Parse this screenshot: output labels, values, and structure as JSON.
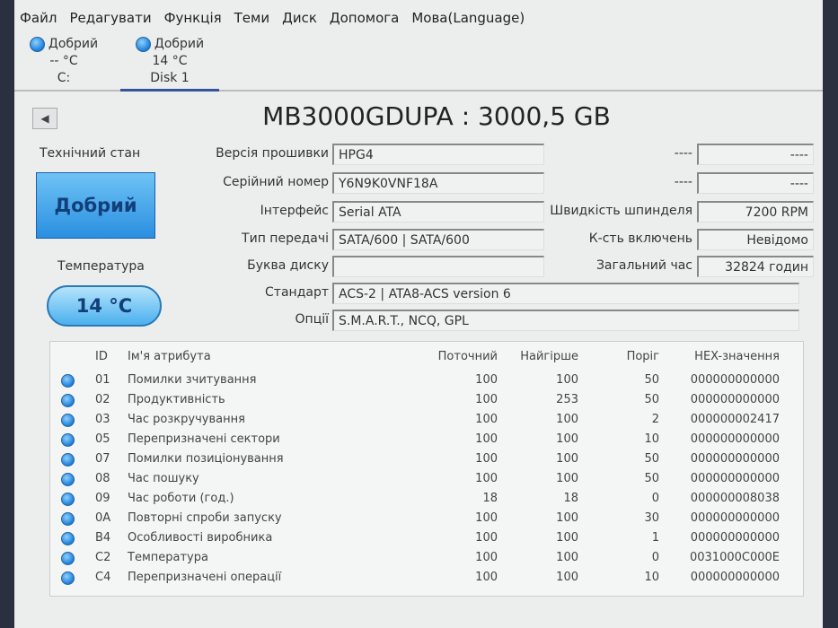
{
  "menu": [
    "Файл",
    "Редагувати",
    "Функція",
    "Теми",
    "Диск",
    "Допомога",
    "Мова(Language)"
  ],
  "disks": [
    {
      "status": "Добрий",
      "temp": "-- °C",
      "name": "C:"
    },
    {
      "status": "Добрий",
      "temp": "14 °C",
      "name": "Disk 1"
    }
  ],
  "title": "MB3000GDUPA : 3000,5 GB",
  "prev_icon": "◀",
  "health_label": "Технічний стан",
  "health_value": "Добрий",
  "temp_label": "Температура",
  "temp_value": "14 °C",
  "fields": [
    {
      "label": "Версія прошивки",
      "value": "HPG4"
    },
    {
      "label": "Серійний номер",
      "value": "Y6N9K0VNF18A"
    },
    {
      "label": "Інтерфейс",
      "value": "Serial ATA"
    },
    {
      "label": "Тип передачі",
      "value": "SATA/600 | SATA/600"
    },
    {
      "label": "Буква диску",
      "value": ""
    },
    {
      "label": "Стандарт",
      "value": "ACS-2 | ATA8-ACS version 6"
    },
    {
      "label": "Опції",
      "value": "S.M.A.R.T., NCQ, GPL"
    }
  ],
  "right_fields": [
    {
      "label": "----",
      "value": "----"
    },
    {
      "label": "----",
      "value": "----"
    },
    {
      "label": "Швидкість шпинделя",
      "value": "7200 RPM"
    },
    {
      "label": "К-сть включень",
      "value": "Невідомо"
    },
    {
      "label": "Загальний час",
      "value": "32824 годин"
    }
  ],
  "table": {
    "headers": {
      "id": "ID",
      "name": "Ім'я атрибута",
      "cur": "Поточний",
      "wst": "Найгірше",
      "thr": "Поріг",
      "hex": "HEX-значення"
    },
    "rows": [
      {
        "id": "01",
        "name": "Помилки зчитування",
        "cur": "100",
        "wst": "100",
        "thr": "50",
        "hex": "000000000000"
      },
      {
        "id": "02",
        "name": "Продуктивність",
        "cur": "100",
        "wst": "253",
        "thr": "50",
        "hex": "000000000000"
      },
      {
        "id": "03",
        "name": "Час розкручування",
        "cur": "100",
        "wst": "100",
        "thr": "2",
        "hex": "000000002417"
      },
      {
        "id": "05",
        "name": "Перепризначені сектори",
        "cur": "100",
        "wst": "100",
        "thr": "10",
        "hex": "000000000000"
      },
      {
        "id": "07",
        "name": "Помилки позиціонування",
        "cur": "100",
        "wst": "100",
        "thr": "50",
        "hex": "000000000000"
      },
      {
        "id": "08",
        "name": "Час пошуку",
        "cur": "100",
        "wst": "100",
        "thr": "50",
        "hex": "000000000000"
      },
      {
        "id": "09",
        "name": "Час роботи (год.)",
        "cur": "18",
        "wst": "18",
        "thr": "0",
        "hex": "000000008038"
      },
      {
        "id": "0A",
        "name": "Повторні спроби запуску",
        "cur": "100",
        "wst": "100",
        "thr": "30",
        "hex": "000000000000"
      },
      {
        "id": "B4",
        "name": "Особливості виробника",
        "cur": "100",
        "wst": "100",
        "thr": "1",
        "hex": "000000000000"
      },
      {
        "id": "C2",
        "name": "Температура",
        "cur": "100",
        "wst": "100",
        "thr": "0",
        "hex": "0031000C000E"
      },
      {
        "id": "C4",
        "name": "Перепризначені операції",
        "cur": "100",
        "wst": "100",
        "thr": "10",
        "hex": "000000000000"
      }
    ]
  }
}
